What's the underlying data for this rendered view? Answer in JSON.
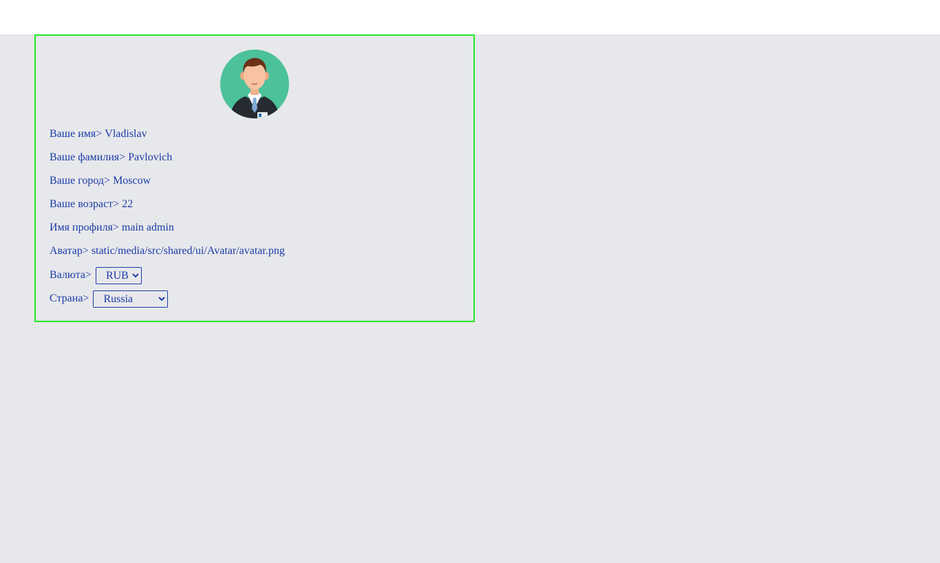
{
  "profile": {
    "name_label": "Ваше имя>",
    "name_value": "Vladislav",
    "surname_label": "Ваше фамилия>",
    "surname_value": "Pavlovich",
    "city_label": "Ваше город>",
    "city_value": "Moscow",
    "age_label": "Ваше возраст>",
    "age_value": "22",
    "username_label": "Имя профиля>",
    "username_value": "main admin",
    "avatar_label": "Аватар>",
    "avatar_value": "static/media/src/shared/ui/Avatar/avatar.png",
    "currency_label": "Валюта>",
    "currency_value": "RUB",
    "country_label": "Страна>",
    "country_value": "Russia"
  },
  "colors": {
    "text": "#1a3aa8",
    "card_border": "#25e825",
    "page_bg": "#e7e8eb",
    "avatar_bg": "#4cc29a"
  },
  "icons": {
    "avatar": "person-avatar-icon"
  }
}
